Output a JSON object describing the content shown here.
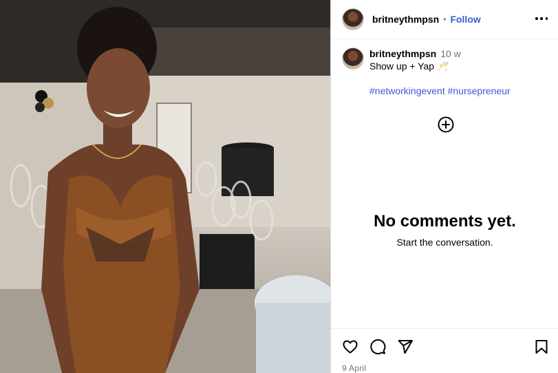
{
  "post": {
    "username": "britneythmpsn",
    "follow_label": "Follow",
    "separator": "•"
  },
  "caption": {
    "username": "britneythmpsn",
    "time": "10 w",
    "text": "Show up + Yap 🥂",
    "hashtags": "#networkingevent #nursepreneur"
  },
  "comments": {
    "empty_title": "No comments yet.",
    "empty_subtitle": "Start the conversation."
  },
  "footer": {
    "date": "9 April"
  },
  "icons": {
    "more": "more-options-icon",
    "add": "add-circle-icon",
    "like": "heart-icon",
    "comment": "comment-icon",
    "share": "share-icon",
    "save": "bookmark-icon"
  },
  "colors": {
    "link": "#3a5bd6",
    "muted": "#737373"
  }
}
